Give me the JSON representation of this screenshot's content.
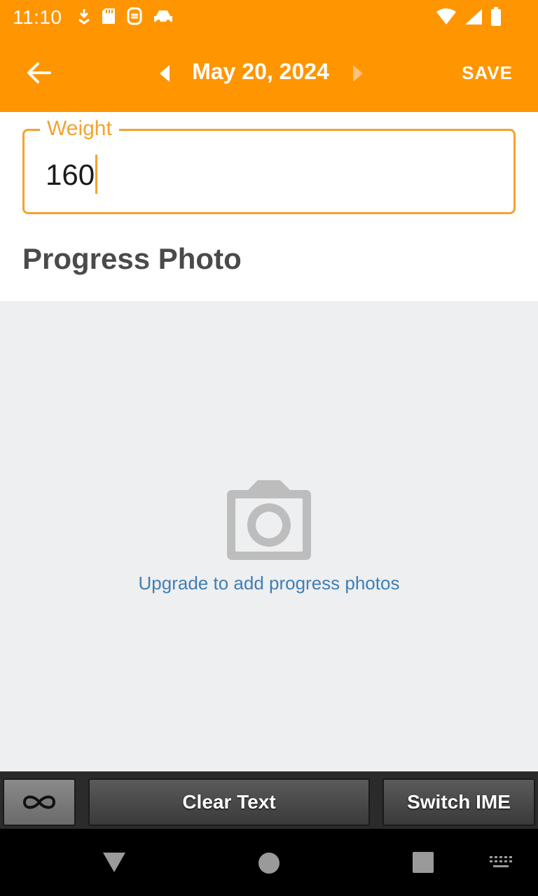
{
  "status_bar": {
    "time": "11:10",
    "icons_left": [
      "download-icon",
      "sd-card-icon",
      "notification-icon",
      "car-icon"
    ],
    "icons_right": [
      "wifi-icon",
      "signal-icon",
      "battery-icon"
    ]
  },
  "app_bar": {
    "back_icon": "arrow-left-icon",
    "prev_icon": "triangle-left-icon",
    "date": "May 20, 2024",
    "next_icon": "triangle-right-icon",
    "save_label": "SAVE",
    "background": "#FF9500"
  },
  "weight": {
    "label": "Weight",
    "value": "160",
    "accent": "#F5A22E"
  },
  "progress_photo": {
    "title": "Progress Photo",
    "icon": "camera-icon",
    "upgrade_text": "Upgrade to add progress photos",
    "link_color": "#3F7FB5"
  },
  "ime_bar": {
    "infinity_icon": "infinity-icon",
    "clear_label": "Clear Text",
    "switch_label": "Switch IME"
  },
  "nav_bar": {
    "icons": [
      "back-triangle-icon",
      "home-circle-icon",
      "recents-square-icon",
      "keyboard-icon"
    ]
  }
}
